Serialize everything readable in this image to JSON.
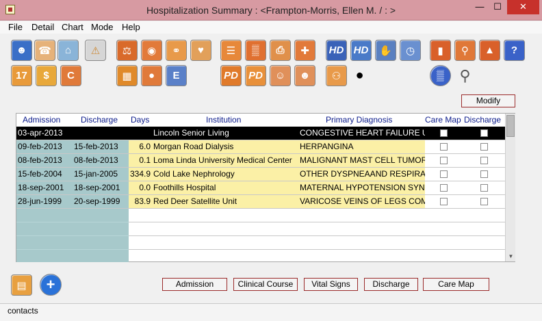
{
  "window": {
    "title": "Hospitalization Summary : <Frampton-Morris, Ellen M. /  : >",
    "minimize": "—",
    "maximize": "☐",
    "close": "✕"
  },
  "menu": [
    "File",
    "Detail",
    "Chart",
    "Mode",
    "Help"
  ],
  "toolbar": {
    "buttons": [
      {
        "icon": "person-icon"
      },
      {
        "icon": "phone-icon"
      },
      {
        "icon": "home-icon"
      },
      {
        "icon": "warning-icon"
      },
      {
        "icon": "gavel-icon"
      },
      {
        "icon": "pills-icon"
      },
      {
        "icon": "stethoscope-icon"
      },
      {
        "icon": "handshake-icon"
      },
      {
        "icon": "document-icon"
      },
      {
        "icon": "chart-icon"
      },
      {
        "icon": "printer-icon"
      },
      {
        "icon": "medical-kit-icon"
      },
      {
        "icon": "hd-icon",
        "label": "HD"
      },
      {
        "icon": "hd-icon",
        "label": "HD"
      },
      {
        "icon": "hand-icon"
      },
      {
        "icon": "clock-icon"
      },
      {
        "icon": "test-tubes-icon"
      },
      {
        "icon": "magnifier-report-icon"
      },
      {
        "icon": "lab-icon"
      },
      {
        "icon": "help-icon",
        "label": "?"
      },
      {
        "icon": "calendar-icon",
        "label": "17"
      },
      {
        "icon": "dollar-icon",
        "label": "$"
      },
      {
        "icon": "c-icon",
        "label": "C"
      },
      {
        "icon": "puzzle-icon"
      },
      {
        "icon": "apple-icon"
      },
      {
        "icon": "flag-icon",
        "label": "E"
      },
      {
        "icon": "pd-icon",
        "label": "PD"
      },
      {
        "icon": "pd-icon",
        "label": "PD"
      },
      {
        "icon": "body-front-icon"
      },
      {
        "icon": "body-back-icon"
      },
      {
        "icon": "group-icon"
      },
      {
        "icon": "camera-icon"
      },
      {
        "icon": "bar-chart-icon"
      },
      {
        "icon": "zoom-icon"
      }
    ]
  },
  "modify_label": "Modify",
  "table": {
    "headers": {
      "admission": "Admission",
      "discharge": "Discharge",
      "days": "Days",
      "institution": "Institution",
      "diagnosis": "Primary Diagnosis",
      "care_map": "Care Map",
      "discharge_flag": "Discharge"
    },
    "rows": [
      {
        "admission": "03-apr-2013",
        "discharge": "",
        "days": "",
        "institution": "Lincoln Senior Living",
        "diagnosis": "CONGESTIVE HEART FAILURE U",
        "selected": true
      },
      {
        "admission": "09-feb-2013",
        "discharge": "15-feb-2013",
        "days": "6.0",
        "institution": "Morgan Road Dialysis",
        "diagnosis": "HERPANGINA",
        "selected": false
      },
      {
        "admission": "08-feb-2013",
        "discharge": "08-feb-2013",
        "days": "0.1",
        "institution": "Loma Linda University Medical Center",
        "diagnosis": "MALIGNANT MAST CELL TUMOR",
        "selected": false
      },
      {
        "admission": "15-feb-2004",
        "discharge": "15-jan-2005",
        "days": "334.9",
        "institution": "Cold Lake Nephrology",
        "diagnosis": "OTHER DYSPNEAAND RESPIRA",
        "selected": false
      },
      {
        "admission": "18-sep-2001",
        "discharge": "18-sep-2001",
        "days": "0.0",
        "institution": "Foothills Hospital",
        "diagnosis": "MATERNAL HYPOTENSION SYNI",
        "selected": false
      },
      {
        "admission": "28-jun-1999",
        "discharge": "20-sep-1999",
        "days": "83.9",
        "institution": "Red Deer Satellite Unit",
        "diagnosis": "VARICOSE VEINS OF LEGS COM",
        "selected": false
      }
    ]
  },
  "bottom_buttons": {
    "admission": "Admission",
    "clinical_course": "Clinical Course",
    "vital_signs": "Vital Signs",
    "discharge": "Discharge",
    "care_map": "Care Map"
  },
  "status": "contacts",
  "colors": {
    "titlebar": "#d79aa2",
    "header_text": "#0a1a8a",
    "teal_column": "#a7c9cb",
    "yellow_column": "#fbf0a6",
    "button_border": "#9a2a2a"
  }
}
